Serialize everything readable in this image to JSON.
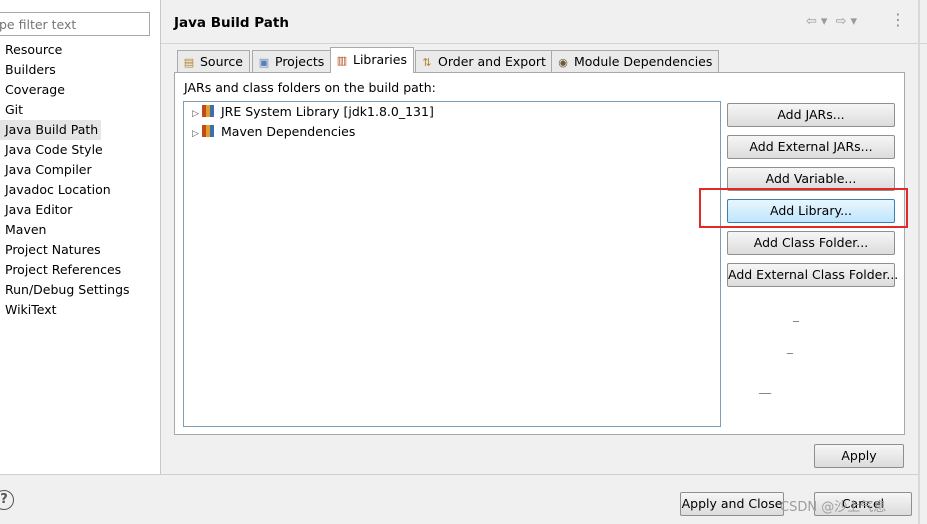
{
  "sidebar": {
    "filter_placeholder": "pe filter text",
    "items": [
      "Resource",
      "Builders",
      "Coverage",
      "Git",
      "Java Build Path",
      "Java Code Style",
      "Java Compiler",
      "Javadoc Location",
      "Java Editor",
      "Maven",
      "Project Natures",
      "Project References",
      "Run/Debug Settings",
      "WikiText"
    ],
    "selected": "Java Build Path"
  },
  "header": {
    "title": "Java Build Path",
    "back_icon": "⇦",
    "dropdown_icon": "▾",
    "forward_icon": "⇨",
    "menu_icon": "⋮"
  },
  "tabs": [
    {
      "label": "Source",
      "icon": "source-folder-icon"
    },
    {
      "label": "Projects",
      "icon": "projects-icon"
    },
    {
      "label": "Libraries",
      "icon": "libraries-icon"
    },
    {
      "label": "Order and Export",
      "icon": "order-export-icon"
    },
    {
      "label": "Module Dependencies",
      "icon": "module-icon"
    }
  ],
  "active_tab": "Libraries",
  "libraries": {
    "label": "JARs and class folders on the build path:",
    "items": [
      "JRE System Library [jdk1.8.0_131]",
      "Maven Dependencies"
    ]
  },
  "buttons": {
    "add_jars": "Add JARs...",
    "add_external_jars": "Add External JARs...",
    "add_variable": "Add Variable...",
    "add_library": "Add Library...",
    "add_class_folder": "Add Class Folder...",
    "add_external_class_folder": "Add External Class Folder...",
    "dash1": "_",
    "dash2": "_",
    "dash3": "__"
  },
  "footer": {
    "apply": "Apply",
    "apply_and_close": "Apply and Close",
    "cancel": "Cancel",
    "help": "?",
    "watermark": "CSDN @沙上气息"
  },
  "colors": {
    "highlight_box": "#e02a2a",
    "focused_button": "#bee6fd"
  }
}
